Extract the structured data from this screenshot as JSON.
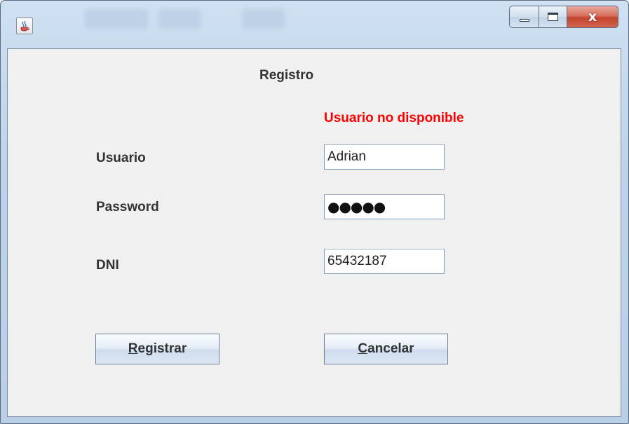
{
  "window": {
    "title": "",
    "controls": {
      "minimize_icon": "minimize-icon",
      "maximize_icon": "maximize-icon",
      "close_symbol": "x"
    },
    "app_icon": "java-cup-icon"
  },
  "form": {
    "title": "Registro",
    "error_message": "Usuario no disponible",
    "error_color": "#ff0000",
    "fields": {
      "usuario": {
        "label": "Usuario",
        "value": "Adrian"
      },
      "password": {
        "label": "Password",
        "masked_value": "●●●●●"
      },
      "dni": {
        "label": "DNI",
        "value": "65432187"
      }
    },
    "buttons": {
      "registrar": {
        "mnemonic": "R",
        "rest": "egistrar"
      },
      "cancelar": {
        "mnemonic": "C",
        "rest": "ancelar"
      }
    }
  }
}
